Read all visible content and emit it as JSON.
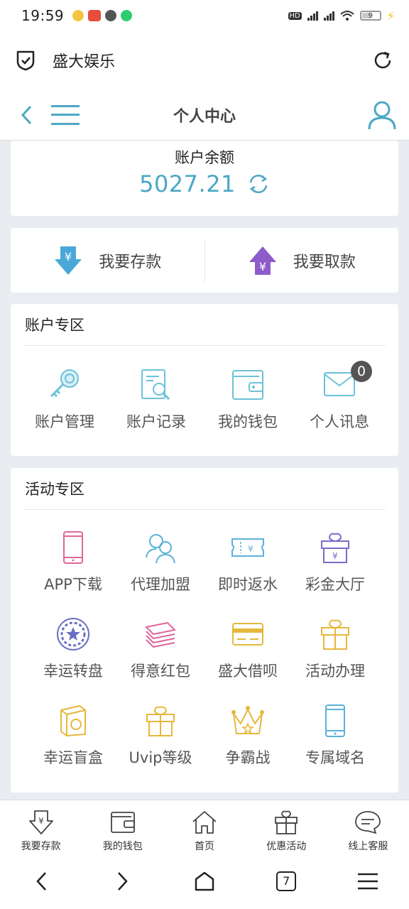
{
  "status_bar": {
    "time": "19:59",
    "battery": "9"
  },
  "browser": {
    "site_title": "盛大娱乐"
  },
  "header": {
    "title": "个人中心"
  },
  "balance": {
    "label": "账户余额",
    "amount": "5027.21"
  },
  "actions": {
    "deposit": "我要存款",
    "withdraw": "我要取款"
  },
  "account_section": {
    "title": "账户专区",
    "items": [
      {
        "label": "账户管理",
        "icon": "key-icon"
      },
      {
        "label": "账户记录",
        "icon": "record-search-icon"
      },
      {
        "label": "我的钱包",
        "icon": "wallet-icon"
      },
      {
        "label": "个人讯息",
        "icon": "mail-icon",
        "badge": "0"
      }
    ]
  },
  "activity_section": {
    "title": "活动专区",
    "items": [
      {
        "label": "APP下载",
        "icon": "phone-icon",
        "color": "#e0669a"
      },
      {
        "label": "代理加盟",
        "icon": "users-icon",
        "color": "#5bb2d6"
      },
      {
        "label": "即时返水",
        "icon": "ticket-icon",
        "color": "#5bb2d6"
      },
      {
        "label": "彩金大厅",
        "icon": "gift-icon",
        "color": "#7b6bc8"
      },
      {
        "label": "幸运转盘",
        "icon": "wheel-icon",
        "color": "#6a6fc4"
      },
      {
        "label": "得意红包",
        "icon": "money-stack-icon",
        "color": "#e0669a"
      },
      {
        "label": "盛大借呗",
        "icon": "card-icon",
        "color": "#e5b83c"
      },
      {
        "label": "活动办理",
        "icon": "gift-icon",
        "color": "#e5b83c"
      },
      {
        "label": "幸运盲盒",
        "icon": "blind-box-icon",
        "color": "#e5b83c"
      },
      {
        "label": "Uvip等级",
        "icon": "gift-icon",
        "color": "#e5b83c"
      },
      {
        "label": "争霸战",
        "icon": "crown-icon",
        "color": "#e5b83c"
      },
      {
        "label": "专属域名",
        "icon": "phone-icon",
        "color": "#5bb2d6"
      }
    ]
  },
  "tabbar": [
    {
      "label": "我要存款",
      "icon": "deposit-icon"
    },
    {
      "label": "我的钱包",
      "icon": "wallet-icon"
    },
    {
      "label": "首页",
      "icon": "home-icon"
    },
    {
      "label": "优惠活动",
      "icon": "gift-icon"
    },
    {
      "label": "线上客服",
      "icon": "chat-icon"
    }
  ],
  "system_nav": {
    "tab_count": "7"
  },
  "colors": {
    "accent": "#4aa8c4",
    "deposit": "#4aa8d8",
    "withdraw": "#8e5cc8"
  }
}
